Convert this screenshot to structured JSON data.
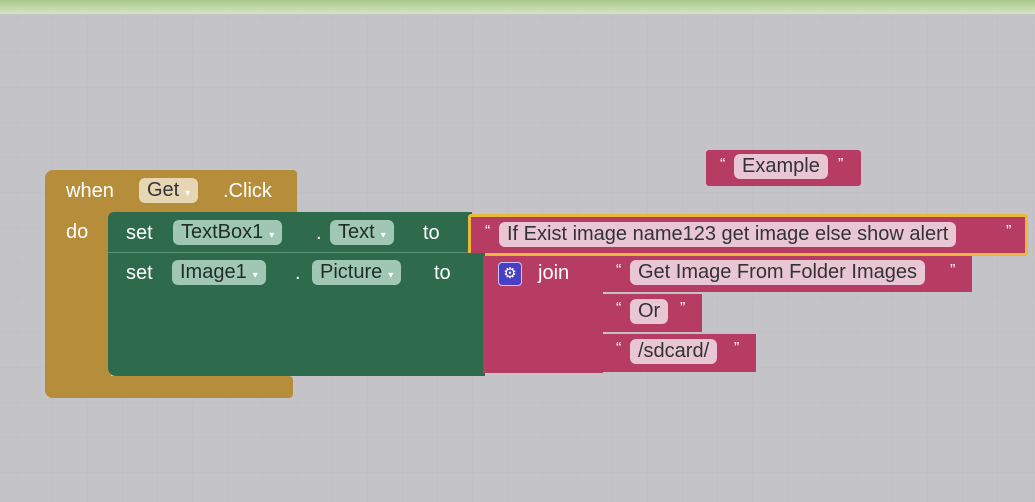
{
  "event_block": {
    "when": "when",
    "component": "Get",
    "event": ".Click",
    "do": "do"
  },
  "set_text": {
    "set": "set",
    "component": "TextBox1",
    "dot": ".",
    "property": "Text",
    "to": "to",
    "value": "If Exist image name123 get image   else show alert"
  },
  "set_picture": {
    "set": "set",
    "component": "Image1",
    "dot": ".",
    "property": "Picture",
    "to": "to",
    "join": "join",
    "items": [
      "Get Image From Folder Images",
      "Or",
      "/sdcard/"
    ]
  },
  "loose_text": "Example",
  "quote_open": "“",
  "quote_close": "”",
  "dropdown_icon": "▾",
  "colors": {
    "event": "#b68d3b",
    "setter": "#2e6b4c",
    "text": "#b73c63",
    "join_gear": "#4a3fc4",
    "highlight": "#e9b93c"
  }
}
